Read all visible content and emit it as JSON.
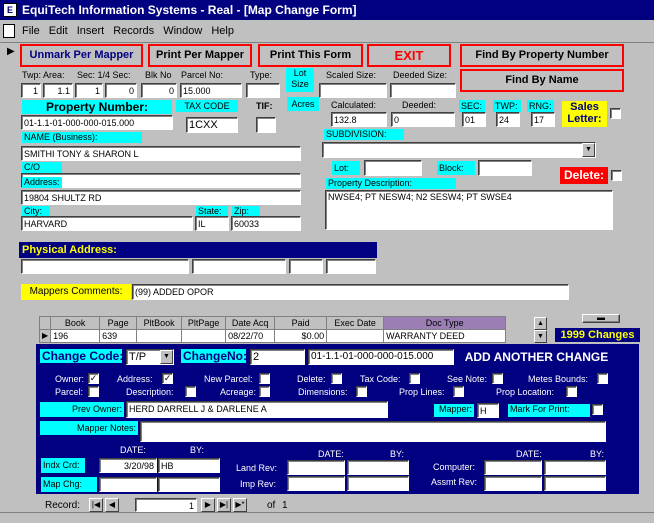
{
  "window": {
    "title": "EquiTech Information Systems - Real - [Map Change Form]"
  },
  "menu": [
    "File",
    "Edit",
    "Insert",
    "Records",
    "Window",
    "Help"
  ],
  "buttons": {
    "unmark": "Unmark Per Mapper",
    "print_mapper": "Print Per Mapper",
    "print_form": "Print This Form",
    "exit": "EXIT",
    "find_prop": "Find By Property Number",
    "find_name": "Find By Name"
  },
  "parcel_labels": {
    "twp_area": "Twp: Area:",
    "sec_qtr": "Sec: 1/4 Sec:",
    "blk_no": "Blk No",
    "parcel_no": "Parcel No:",
    "type": "Type:",
    "lot_size": "Lot Size",
    "scaled_size": "Scaled Size:",
    "deeded_size": "Deeded Size:",
    "acres": "Acres",
    "calculated": "Calculated:",
    "deeded": "Deeded:"
  },
  "parcel": {
    "twp": "1",
    "area": "1.1",
    "sec": "1",
    "qtr": "0",
    "blk": "0",
    "parcel_no": "15.000",
    "type": "",
    "scaled_size": "",
    "deeded_size": "",
    "calculated": "132.8",
    "deeded": "0"
  },
  "property": {
    "label": "Property Number:",
    "value": "01-1.1-01-000-000-015.000",
    "tax_code_label": "TAX CODE",
    "tax_code": "1CXX",
    "tif_label": "TIF:",
    "tif": ""
  },
  "str": {
    "sec_label": "SEC:",
    "sec": "01",
    "twp_label": "TWP:",
    "twp": "24",
    "rng_label": "RNG:",
    "rng": "17"
  },
  "sales_letter": "Sales Letter:",
  "owner": {
    "name_label": "NAME (Business):",
    "name": "SMITHI TONY & SHARON L",
    "co_label": "C/O",
    "co": "",
    "address_label": "Address:",
    "address": "19804 SHULTZ RD",
    "city_label": "City:",
    "city": "HARVARD",
    "state_label": "State:",
    "state": "IL",
    "zip_label": "Zip:",
    "zip": "60033"
  },
  "subdivision": {
    "label": "SUBDIVISION:",
    "value": "",
    "lot_label": "Lot:",
    "lot": "",
    "block_label": "Block:",
    "block": ""
  },
  "delete_label": "Delete:",
  "prop_desc": {
    "label": "Property Description:",
    "value": "NWSE4; PT NESW4; N2 SESW4; PT SWSE4"
  },
  "physical_address": {
    "label": "Physical Address:"
  },
  "mappers_comments": {
    "label": "Mappers Comments:",
    "value": "(99) ADDED OPOR"
  },
  "deeds": {
    "headers": [
      "Book",
      "Page",
      "PltBook",
      "PltPage",
      "Date Acq",
      "Paid",
      "Exec Date",
      "Doc Type"
    ],
    "rows": [
      [
        "196",
        "639",
        "",
        "",
        "08/22/70",
        "$0.00",
        "",
        "WARRANTY DEED"
      ]
    ]
  },
  "changes_label": "1999 Changes",
  "change": {
    "code_label": "Change Code:",
    "code": "T/P",
    "no_label": "ChangeNo:",
    "no": "2",
    "prop_no": "01-1.1-01-000-000-015.000",
    "add_another": "ADD ANOTHER CHANGE"
  },
  "checks": {
    "owner": "Owner:",
    "address": "Address:",
    "new_parcel": "New Parcel:",
    "delete": "Delete:",
    "tax_code": "Tax Code:",
    "see_note": "See Note:",
    "metes": "Metes Bounds:",
    "parcel": "Parcel:",
    "description": "Description:",
    "acreage": "Acreage:",
    "dimensions": "Dimensions:",
    "prop_lines": "Prop Lines:",
    "prop_location": "Prop Location:",
    "mark_print": "Mark For Print:",
    "checked_mark": "✓"
  },
  "prev_owner": {
    "label": "Prev Owner:",
    "value": "HERD DARRELL J & DARLENE A"
  },
  "mapper": {
    "label": "Mapper:",
    "value": "H"
  },
  "mapper_notes": {
    "label": "Mapper Notes:",
    "value": ""
  },
  "bottom": {
    "date_label": "DATE:",
    "by_label": "BY:",
    "indx_crd": "Indx Crd:",
    "indx_date": "3/20/98",
    "indx_by": "HB",
    "map_chg": "Map Chg:",
    "land_rev": "Land Rev:",
    "imp_rev": "Imp Rev:",
    "computer": "Computer:",
    "assmt_rev": "Assmt Rev:"
  },
  "record": {
    "label": "Record:",
    "current": "1",
    "of_label": "of",
    "total": "1"
  }
}
